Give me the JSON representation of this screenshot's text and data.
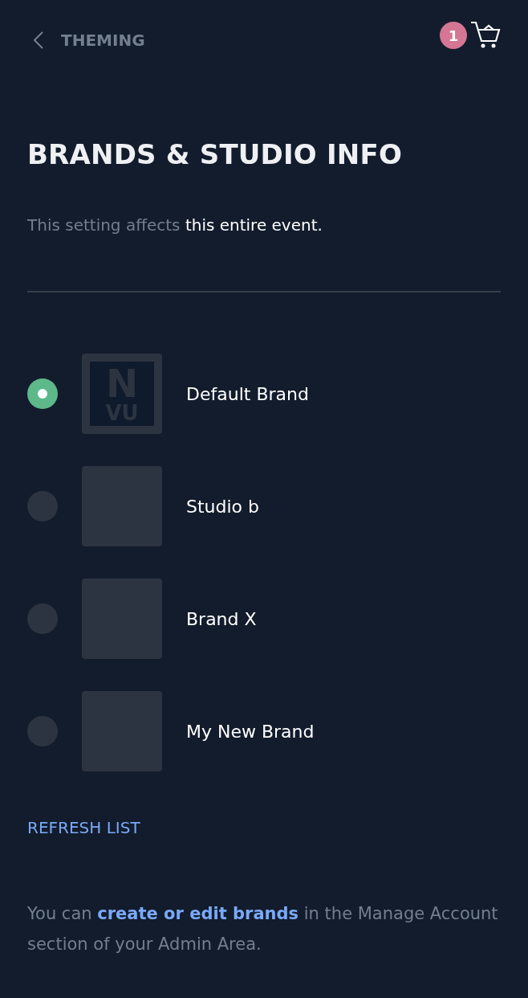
{
  "header": {
    "back_label": "THEMING",
    "cart_count": "1"
  },
  "title": "BRANDS & STUDIO INFO",
  "description": "This setting affects **this entire event.**",
  "brands": [
    {
      "name": "Default Brand",
      "selected": true,
      "logo_text": [
        "N",
        "VU"
      ]
    },
    {
      "name": "Studio b",
      "selected": false
    },
    {
      "name": "Brand X",
      "selected": false
    },
    {
      "name": "My New Brand",
      "selected": false
    }
  ],
  "refresh_label": "REFRESH LIST",
  "footer": {
    "before": "You can",
    "link": "create or edit brands",
    "after": "in the Manage Account section of your Admin Area."
  }
}
